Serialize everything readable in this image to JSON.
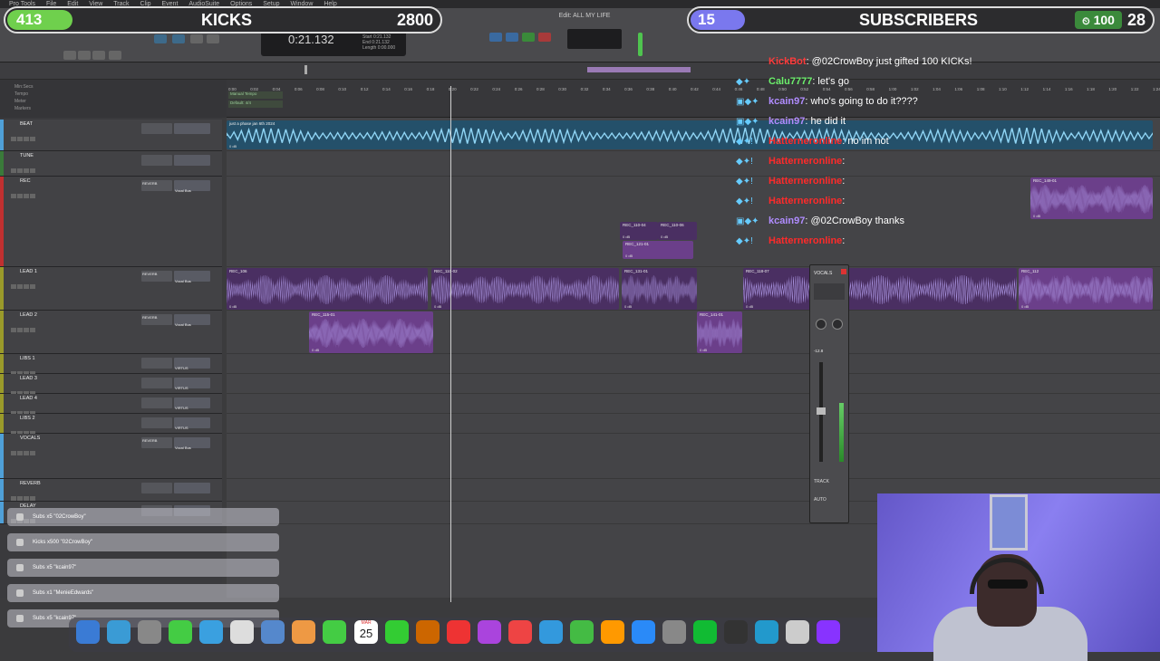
{
  "menubar": {
    "items": [
      "Pro Tools",
      "File",
      "Edit",
      "View",
      "Track",
      "Clip",
      "Event",
      "AudioSuite",
      "Options",
      "Setup",
      "Window",
      "Help"
    ]
  },
  "toolbar": {
    "edit_window_title": "Edit: ALL MY LIFE",
    "main_counter": "0:21.132",
    "sub_counter_labels": [
      "Start",
      "End",
      "Length"
    ],
    "sub_counter_values": [
      "0:21.132",
      "0:21.132",
      "0:00.000"
    ]
  },
  "kicks": {
    "count": "413",
    "label": "KICKS",
    "goal": "2800",
    "bar_color": "#6fd04d"
  },
  "subscribers": {
    "count": "15",
    "label": "SUBSCRIBERS",
    "badge": "100",
    "goal": "28",
    "bar_color": "#7a78ee"
  },
  "ruler": {
    "rows": [
      "Min:Secs",
      "Tempo",
      "Meter",
      "Markers"
    ],
    "tempo_value": "Manual Tempo",
    "meter_value": "Default: 4/4",
    "ticks": [
      "0:00",
      "0:02",
      "0:04",
      "0:06",
      "0:08",
      "0:10",
      "0:12",
      "0:14",
      "0:16",
      "0:18",
      "0:20",
      "0:22",
      "0:24",
      "0:26",
      "0:28",
      "0:30",
      "0:32",
      "0:34",
      "0:36",
      "0:38",
      "0:40",
      "0:42",
      "0:44",
      "0:46",
      "0:48",
      "0:50",
      "0:52",
      "0:54",
      "0:56",
      "0:58",
      "1:00",
      "1:02",
      "1:04",
      "1:06",
      "1:08",
      "1:10",
      "1:12",
      "1:14",
      "1:16",
      "1:18",
      "1:20",
      "1:22",
      "1:24"
    ]
  },
  "tracks": [
    {
      "name": "BEAT",
      "color": "#4fa0d8",
      "inserts": "",
      "io": ""
    },
    {
      "name": "TUNE",
      "color": "#3a7a3a",
      "inserts": "",
      "io": ""
    },
    {
      "name": "REC",
      "color": "#c03030",
      "inserts": "REVERB",
      "io": "Vocal Bus"
    },
    {
      "name": "LEAD 1",
      "color": "#9a9a2a",
      "inserts": "REVERB",
      "io": "Vocal Bus"
    },
    {
      "name": "LEAD 2",
      "color": "#9a9a2a",
      "inserts": "REVERB",
      "io": "Vocal Bus"
    },
    {
      "name": "LIBS 1",
      "color": "#9a9a2a",
      "inserts": "",
      "io": "VIRTUS"
    },
    {
      "name": "LEAD 3",
      "color": "#9a9a2a",
      "inserts": "",
      "io": "VIRTUS"
    },
    {
      "name": "LEAD 4",
      "color": "#9a9a2a",
      "inserts": "",
      "io": "VIRTUS"
    },
    {
      "name": "LIBS 2",
      "color": "#9a9a2a",
      "inserts": "",
      "io": "VIRTUS"
    },
    {
      "name": "VOCALS",
      "color": "#4fa0d8",
      "inserts": "REVERB",
      "io": "Vocal Bus"
    },
    {
      "name": "REVERB",
      "color": "#4fa0d8",
      "inserts": "",
      "io": ""
    },
    {
      "name": "DELAY",
      "color": "#4fa0d8",
      "inserts": "",
      "io": ""
    }
  ],
  "clips": {
    "beat": "just a phase jan 6th 2024",
    "rec": [
      "REC_110-04",
      "REC_110-06",
      "REC_121-01",
      "REC_149-01"
    ],
    "lead1": [
      "REC_106",
      "REC_110-02",
      "REC_131-01",
      "REC_118-07",
      "REC_112"
    ],
    "lead2": [
      "REC_115-01",
      "REC_141-01"
    ],
    "db": "0 dB"
  },
  "chat": [
    {
      "user": "KickBot",
      "color": "#ff3b3b",
      "text": ": @02CrowBoy just gifted 100 KICKs!",
      "badges": ""
    },
    {
      "user": "Calu7777",
      "color": "#6cf06c",
      "text": ": let's go",
      "badges": "◆✦"
    },
    {
      "user": "kcain97",
      "color": "#b08cff",
      "text": ": who's going to do it????",
      "badges": "▣◆✦"
    },
    {
      "user": "kcain97",
      "color": "#b08cff",
      "text": ": he did it",
      "badges": "▣◆✦"
    },
    {
      "user": "Hatterneronline",
      "color": "#ff2a2a",
      "text": ": no im not",
      "badges": "◆✦!"
    },
    {
      "user": "Hatterneronline",
      "color": "#ff2a2a",
      "text": ":",
      "badges": "◆✦!"
    },
    {
      "user": "Hatterneronline",
      "color": "#ff2a2a",
      "text": ":",
      "badges": "◆✦!"
    },
    {
      "user": "Hatterneronline",
      "color": "#ff2a2a",
      "text": ":",
      "badges": "◆✦!"
    },
    {
      "user": "kcain97",
      "color": "#b08cff",
      "text": ": @02CrowBoy thanks",
      "badges": "▣◆✦"
    },
    {
      "user": "Hatterneronline",
      "color": "#ff2a2a",
      "text": ":",
      "badges": "◆✦!"
    }
  ],
  "mixer": {
    "name": "VOCALS",
    "value": "-12.8",
    "label_track": "TRACK",
    "label_auto": "AUTO"
  },
  "alerts": [
    "Subs x5 \"02CrowBoy\"",
    "Kicks x500 \"02CrowBoy\"",
    "Subs x5 \"kcain97\"",
    "Subs x1 \"MenieEdwards\"",
    "Subs x5 \"kcain97\""
  ],
  "dock": {
    "calendar_month": "MAR",
    "calendar_day": "25"
  }
}
